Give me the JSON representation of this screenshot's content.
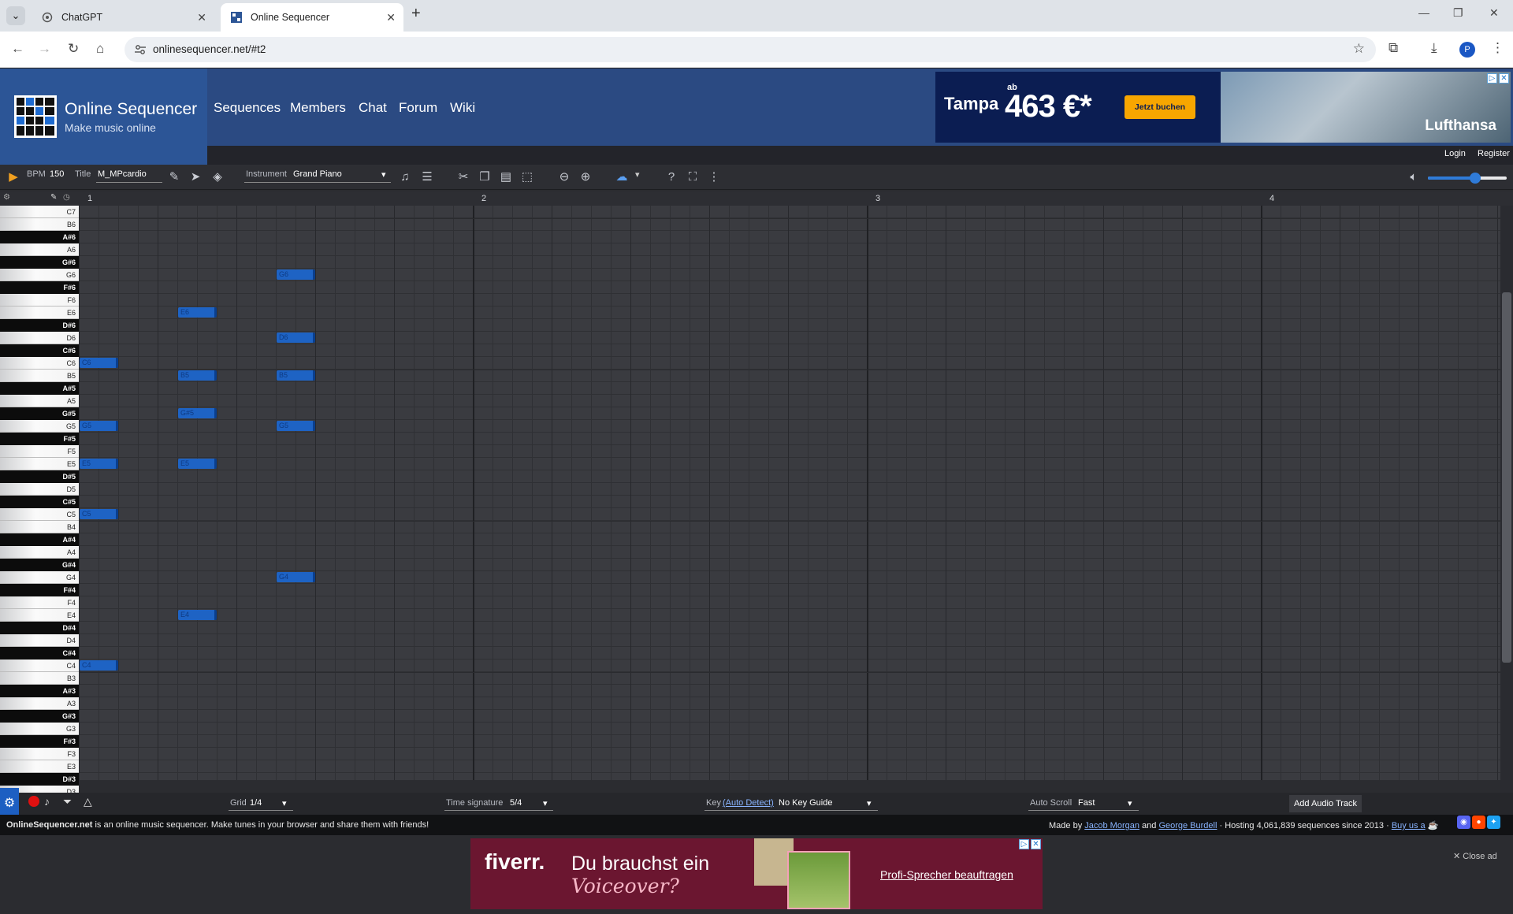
{
  "browser": {
    "tabs": [
      {
        "title": "ChatGPT",
        "active": false
      },
      {
        "title": "Online Sequencer",
        "active": true
      }
    ],
    "url": "onlinesequencer.net/#t2",
    "profile_initial": "P"
  },
  "site": {
    "title": "Online Sequencer",
    "subtitle": "Make music online",
    "nav": [
      "Sequences",
      "Members",
      "Chat",
      "Forum",
      "Wiki"
    ],
    "login": "Login",
    "register": "Register"
  },
  "ad_top": {
    "city": "Tampa",
    "ab": "ab",
    "price": "463 €*",
    "cta": "Jetzt buchen",
    "brand": "Lufthansa"
  },
  "toolbar": {
    "bpm_label": "BPM",
    "bpm_value": "150",
    "title_label": "Title",
    "title_value": "M_MPcardio",
    "instrument_label": "Instrument",
    "instrument_value": "Grand Piano",
    "volume": 0.6
  },
  "editor": {
    "measures": [
      "1",
      "2",
      "3",
      "4"
    ],
    "keys": [
      "C7",
      "B6",
      "A#6",
      "A6",
      "G#6",
      "G6",
      "F#6",
      "F6",
      "E6",
      "D#6",
      "D6",
      "C#6",
      "C6",
      "B5",
      "A#5",
      "A5",
      "G#5",
      "G5",
      "F#5",
      "F5",
      "E5",
      "D#5",
      "D5",
      "C#5",
      "C5",
      "B4",
      "A#4",
      "A4",
      "G#4",
      "G4",
      "F#4",
      "F4",
      "E4",
      "D#4",
      "D4",
      "C#4",
      "C4",
      "B3",
      "A#3",
      "A3",
      "G#3",
      "G3",
      "F#3",
      "F3",
      "E3",
      "D#3",
      "D3"
    ],
    "notes": [
      {
        "label": "C6",
        "beat": 0,
        "length": 2
      },
      {
        "label": "G5",
        "beat": 0,
        "length": 2
      },
      {
        "label": "E5",
        "beat": 0,
        "length": 2
      },
      {
        "label": "C5",
        "beat": 0,
        "length": 2
      },
      {
        "label": "C4",
        "beat": 0,
        "length": 2
      },
      {
        "label": "E6",
        "beat": 5,
        "length": 2
      },
      {
        "label": "B5",
        "beat": 5,
        "length": 2
      },
      {
        "label": "G#5",
        "beat": 5,
        "length": 2
      },
      {
        "label": "E5",
        "beat": 5,
        "length": 2
      },
      {
        "label": "E4",
        "beat": 5,
        "length": 2
      },
      {
        "label": "G6",
        "beat": 10,
        "length": 2
      },
      {
        "label": "D6",
        "beat": 10,
        "length": 2
      },
      {
        "label": "B5",
        "beat": 10,
        "length": 2
      },
      {
        "label": "G5",
        "beat": 10,
        "length": 2
      },
      {
        "label": "G4",
        "beat": 10,
        "length": 2
      }
    ]
  },
  "bottombar": {
    "grid_label": "Grid",
    "grid_value": "1/4",
    "timesig_label": "Time signature",
    "timesig_value": "5/4",
    "key_label": "Key",
    "key_autodetect": "(Auto Detect)",
    "key_value": "No Key Guide",
    "autoscroll_label": "Auto Scroll",
    "autoscroll_value": "Fast",
    "add_audio": "Add Audio Track"
  },
  "footer": {
    "brand": "OnlineSequencer.net",
    "tagline": " is an online music sequencer. Make tunes in your browser and share them with friends!",
    "made_by": "Made by ",
    "author1": "Jacob Morgan",
    "and": " and ",
    "author2": "George Burdell",
    "hosting": " · Hosting 4,061,839 sequences since 2013 · ",
    "buy": "Buy us a"
  },
  "ad_bottom": {
    "brand": "fiverr.",
    "line1": "Du brauchst ein",
    "line2": "Voiceover?",
    "cta": "Profi-Sprecher beauftragen",
    "close": "✕ Close ad"
  },
  "colors": {
    "note": "#1e63c4",
    "header": "#2b4a82",
    "accent": "#2f7bd8"
  }
}
